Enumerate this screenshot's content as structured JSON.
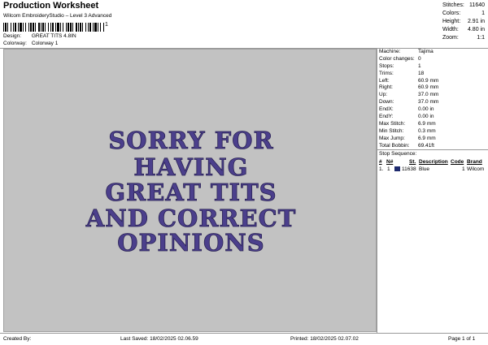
{
  "header": {
    "title": "Production Worksheet",
    "subtitle": "Wilcom EmbroideryStudio – Level 3 Advanced",
    "barcode_suffix": "1"
  },
  "meta": {
    "design_label": "Design:",
    "design_value": "GREAT TITS 4.8IN",
    "colorway_label": "Colorway:",
    "colorway_value": "Colorway 1"
  },
  "top_stats": [
    {
      "label": "Stitches:",
      "value": "11640"
    },
    {
      "label": "Colors:",
      "value": "1"
    },
    {
      "label": "Height:",
      "value": "2.91 in"
    },
    {
      "label": "Width:",
      "value": "4.80 in"
    },
    {
      "label": "Zoom:",
      "value": "1:1"
    }
  ],
  "design_text": {
    "lines": [
      "SORRY FOR",
      "HAVING",
      "GREAT TITS",
      "AND CORRECT",
      "OPINIONS"
    ],
    "fill_color": "#4b3f8c",
    "outline_color": "#2a2255"
  },
  "machine_info": [
    {
      "label": "Machine:",
      "value": "Tajima"
    },
    {
      "label": "Color changes:",
      "value": "0"
    },
    {
      "label": "Stops:",
      "value": "1"
    },
    {
      "label": "Trims:",
      "value": "18"
    },
    {
      "label": "Left:",
      "value": "60.9 mm"
    },
    {
      "label": "Right:",
      "value": "60.9 mm"
    },
    {
      "label": "Up:",
      "value": "37.0 mm"
    },
    {
      "label": "Down:",
      "value": "37.0 mm"
    },
    {
      "label": "EndX:",
      "value": "0.00 in"
    },
    {
      "label": "EndY:",
      "value": "0.00 in"
    },
    {
      "label": "Max Stitch:",
      "value": "6.9 mm"
    },
    {
      "label": "Min Stitch:",
      "value": "0.3 mm"
    },
    {
      "label": "Max Jump:",
      "value": "6.9 mm"
    },
    {
      "label": "Total Bobbin:",
      "value": "69.41ft"
    }
  ],
  "stop_sequence": {
    "heading": "Stop Sequence:",
    "columns": [
      "#",
      "N#",
      "St.",
      "Description",
      "Code",
      "Brand"
    ],
    "rows": [
      {
        "num": "1.",
        "n": "1",
        "st": "11638",
        "description": "Blue",
        "code": "1",
        "brand": "Wilcom",
        "color": "#1e2a6e"
      }
    ]
  },
  "footer": {
    "created_by": "Created By:",
    "last_saved": "Last Saved: 18/02/2025 02.06.59",
    "printed": "Printed: 18/02/2025 02.07.02",
    "page": "Page 1 of 1"
  }
}
